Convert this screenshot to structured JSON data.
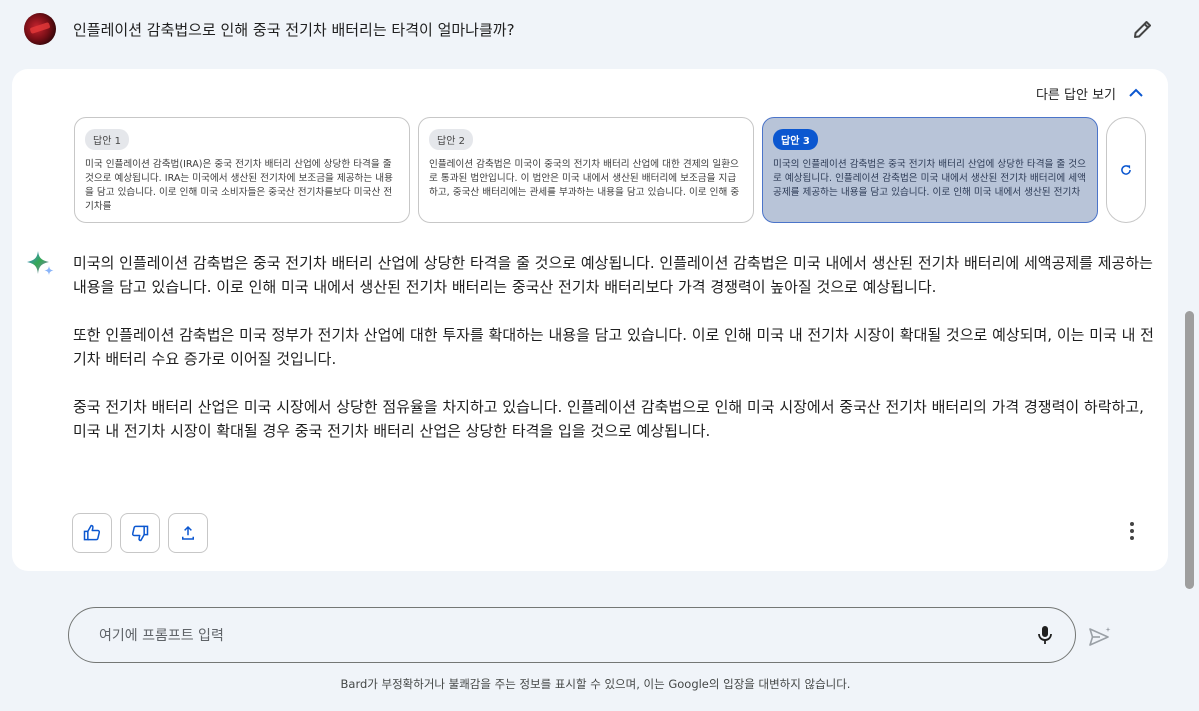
{
  "query": {
    "text": "인플레이션 감축법으로 인해 중국 전기차 배터리는 타격이 얼마나클까?"
  },
  "drafts_toggle": {
    "label": "다른 답안 보기"
  },
  "drafts": [
    {
      "label": "답안 1",
      "text": "미국 인플레이션 감축법(IRA)은 중국 전기차 배터리 산업에 상당한 타격을 줄 것으로 예상됩니다. IRA는 미국에서 생산된 전기차에 보조금을 제공하는 내용을 담고 있습니다. 이로 인해 미국 소비자들은 중국산 전기차를보다 미국산 전기차를"
    },
    {
      "label": "답안 2",
      "text": "인플레이션 감축법은 미국이 중국의 전기차 배터리 산업에 대한 견제의 일환으로 통과된 법안입니다. 이 법안은 미국 내에서 생산된 배터리에 보조금을 지급하고, 중국산 배터리에는 관세를 부과하는 내용을 담고 있습니다. 이로 인해 중"
    },
    {
      "label": "답안 3",
      "text": "미국의 인플레이션 감축법은 중국 전기차 배터리 산업에 상당한 타격을 줄 것으로 예상됩니다. 인플레이션 감축법은 미국 내에서 생산된 전기차 배터리에 세액공제를 제공하는 내용을 담고 있습니다. 이로 인해 미국 내에서 생산된 전기차"
    }
  ],
  "answer": {
    "paragraphs": [
      "미국의 인플레이션 감축법은 중국 전기차 배터리 산업에 상당한 타격을 줄 것으로 예상됩니다. 인플레이션 감축법은 미국 내에서 생산된 전기차 배터리에 세액공제를 제공하는 내용을 담고 있습니다. 이로 인해 미국 내에서 생산된 전기차 배터리는 중국산 전기차 배터리보다 가격 경쟁력이 높아질 것으로 예상됩니다.",
      "또한 인플레이션 감축법은 미국 정부가 전기차 산업에 대한 투자를 확대하는 내용을 담고 있습니다. 이로 인해 미국 내 전기차 시장이 확대될 것으로 예상되며, 이는 미국 내 전기차 배터리 수요 증가로 이어질 것입니다.",
      "중국 전기차 배터리 산업은 미국 시장에서 상당한 점유율을 차지하고 있습니다. 인플레이션 감축법으로 인해 미국 시장에서 중국산 전기차 배터리의 가격 경쟁력이 하락하고, 미국 내 전기차 시장이 확대될 경우 중국 전기차 배터리 산업은 상당한 타격을 입을 것으로 예상됩니다."
    ]
  },
  "prompt": {
    "placeholder": "여기에 프롬프트 입력"
  },
  "disclaimer": "Bard가 부정확하거나 불쾌감을 주는 정보를 표시할 수 있으며, 이는 Google의 입장을 대변하지 않습니다.",
  "colors": {
    "accent": "#0b57d0",
    "selected_draft": "#b8c4d8",
    "background": "#f0f4f9"
  },
  "icons": [
    "pencil-icon",
    "chevron-up-icon",
    "refresh-icon",
    "sparkle-icon",
    "thumbs-up-icon",
    "thumbs-down-icon",
    "share-icon",
    "more-vert-icon",
    "mic-icon",
    "send-icon"
  ]
}
